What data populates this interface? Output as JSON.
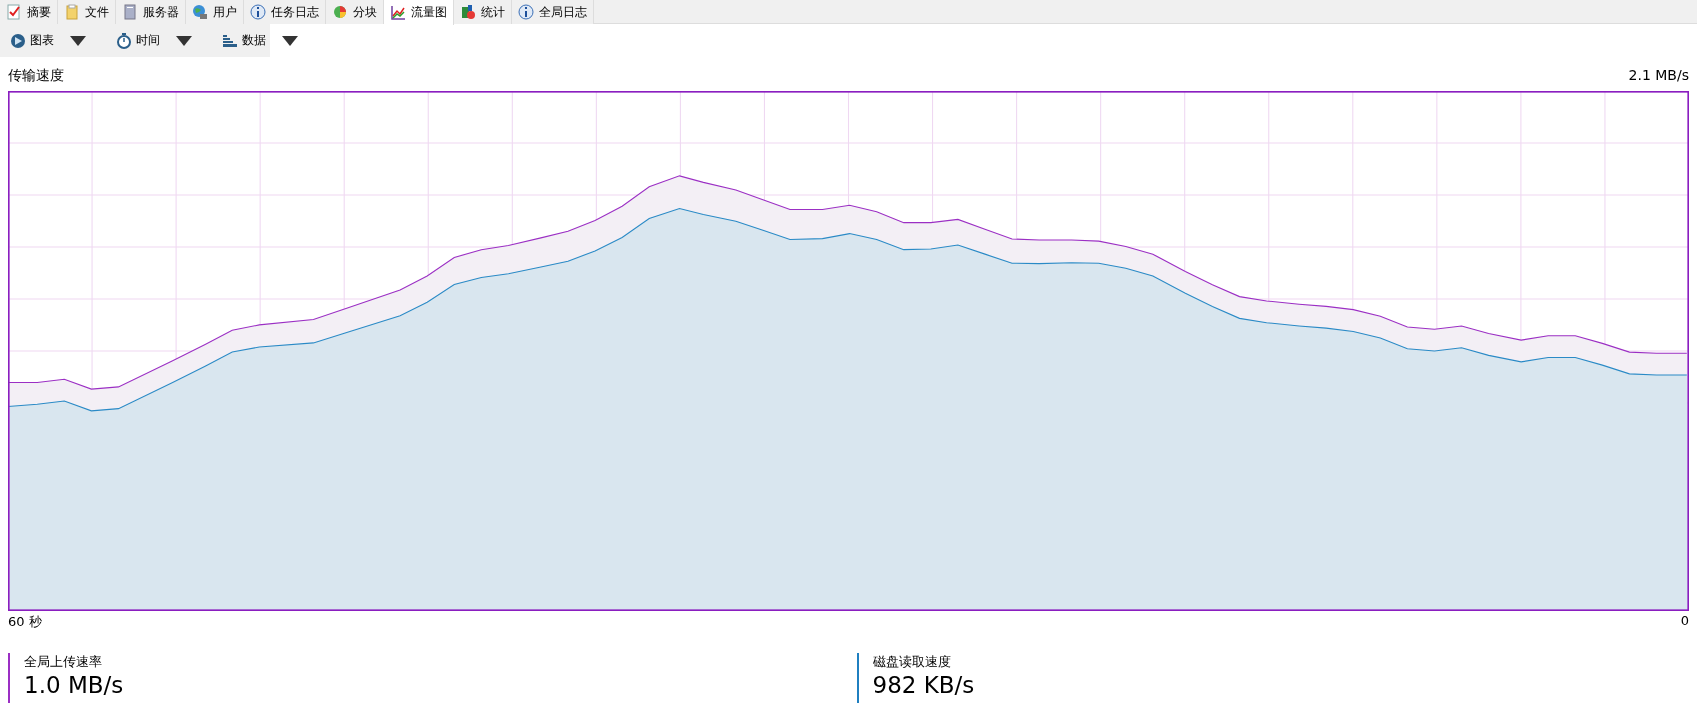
{
  "tabs": [
    {
      "label": "摘要",
      "kind": "check",
      "selected": false
    },
    {
      "label": "文件",
      "kind": "file",
      "selected": false
    },
    {
      "label": "服务器",
      "kind": "server",
      "selected": false
    },
    {
      "label": "用户",
      "kind": "globe",
      "selected": false
    },
    {
      "label": "任务日志",
      "kind": "info",
      "selected": false
    },
    {
      "label": "分块",
      "kind": "pie",
      "selected": false
    },
    {
      "label": "流量图",
      "kind": "graph",
      "selected": true
    },
    {
      "label": "统计",
      "kind": "stats",
      "selected": false
    },
    {
      "label": "全局日志",
      "kind": "info",
      "selected": false
    }
  ],
  "toolbar": [
    {
      "label": "图表",
      "kind": "chart"
    },
    {
      "label": "时间",
      "kind": "timer"
    },
    {
      "label": "数据",
      "kind": "bars"
    }
  ],
  "chart": {
    "title": "传输速度",
    "max_label": "2.1 MB/s",
    "start_label": "60 秒",
    "end_label": "0"
  },
  "stats": [
    {
      "label": "全局上传速率",
      "value": "1.0 MB/s",
      "color": "#9b2fc4"
    },
    {
      "label": "磁盘读取速度",
      "value": "982 KB/s",
      "color": "#1f7fc0"
    }
  ]
}
